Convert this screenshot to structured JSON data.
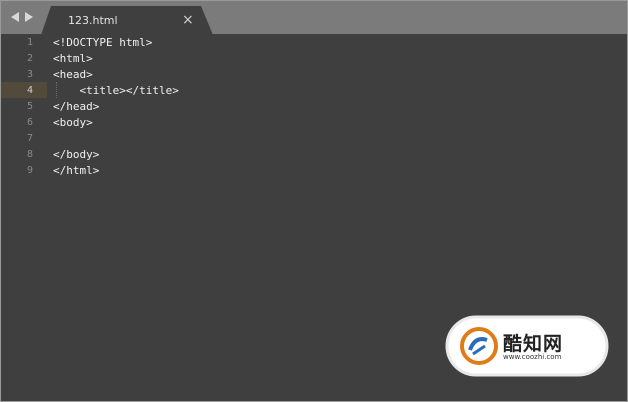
{
  "tab": {
    "title": "123.html",
    "close_glyph": "×"
  },
  "editor": {
    "active_line": 4,
    "lines": [
      {
        "n": "1",
        "code": "<!DOCTYPE html>"
      },
      {
        "n": "2",
        "code": "<html>"
      },
      {
        "n": "3",
        "code": "<head>"
      },
      {
        "n": "4",
        "code": "    <title></title>"
      },
      {
        "n": "5",
        "code": "</head>"
      },
      {
        "n": "6",
        "code": "<body>"
      },
      {
        "n": "7",
        "code": ""
      },
      {
        "n": "8",
        "code": "</body>"
      },
      {
        "n": "9",
        "code": "</html>"
      }
    ]
  },
  "watermark": {
    "brand": "酷知网",
    "url": "www.coozhi.com"
  },
  "icons": {
    "nav_back": "arrow-left-icon",
    "nav_forward": "arrow-right-icon",
    "close": "close-icon",
    "logo": "coozhi-logo-icon"
  },
  "colors": {
    "tabbar": "#7b7b7b",
    "editor_bg": "#3f3f3f",
    "tab_bg": "#3f3f3f",
    "text": "#f0f0f0",
    "gutter_text": "#8a8a8a",
    "active_line": "#524a3a"
  }
}
